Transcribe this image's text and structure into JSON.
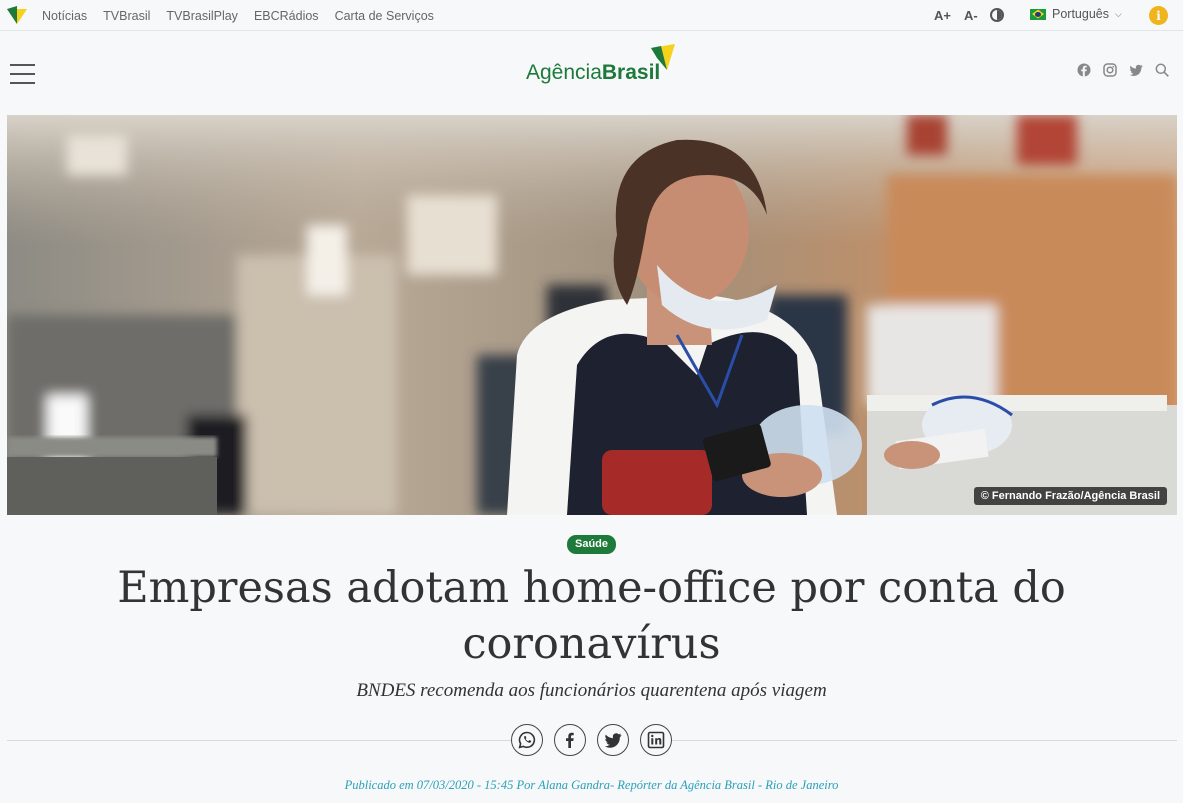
{
  "topbar": {
    "nav": [
      "Notícias",
      "TVBrasil",
      "TVBrasilPlay",
      "EBCRádios",
      "Carta de Serviços"
    ],
    "font_increase": "A+",
    "font_decrease": "A-",
    "language": "Português"
  },
  "header": {
    "brand_light": "Agência",
    "brand_bold": "Brasil",
    "social_icons": [
      "facebook-icon",
      "instagram-icon",
      "twitter-icon",
      "search-icon"
    ]
  },
  "hero": {
    "credit": "© Fernando Frazão/Agência Brasil"
  },
  "article": {
    "tag": "Saúde",
    "title": "Empresas adotam home-office por conta do coronavírus",
    "subtitle": "BNDES recomenda aos funcionários quarentena após viagem",
    "share": [
      "whatsapp-icon",
      "facebook-icon",
      "twitter-icon",
      "linkedin-icon"
    ],
    "byline": "Publicado em 07/03/2020 - 15:45 Por Alana Gandra- Repórter da Agência Brasil - Rio de Janeiro"
  },
  "colors": {
    "brand_green": "#1e7a3a",
    "brand_yellow": "#f7d21c",
    "byline": "#2aa0b8"
  }
}
